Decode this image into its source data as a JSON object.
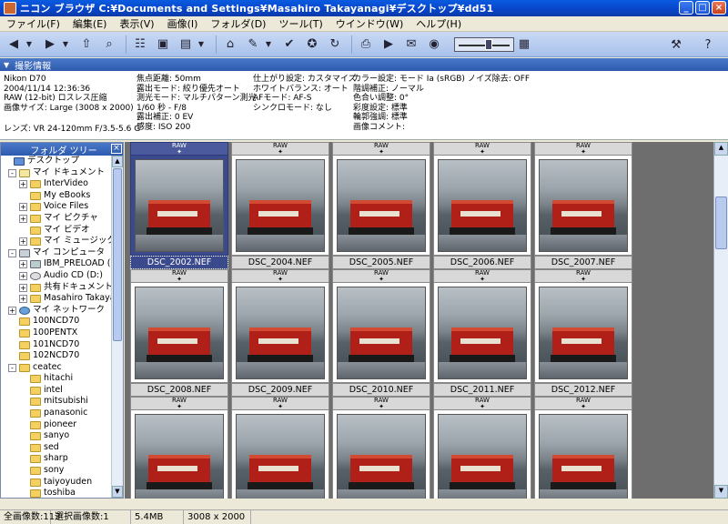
{
  "window": {
    "title": "ニコン ブラウザ C:¥Documents and Settings¥Masahiro Takayanagi¥デスクトップ¥dd51"
  },
  "menu": [
    "ファイル(F)",
    "編集(E)",
    "表示(V)",
    "画像(I)",
    "フォルダ(D)",
    "ツール(T)",
    "ウインドウ(W)",
    "ヘルプ(H)"
  ],
  "info_header": "撮影情報",
  "info_columns": [
    [
      "Nikon D70",
      "2004/11/14 12:36:36",
      "RAW (12-bit) ロスレス圧縮",
      "画像サイズ: Large (3008 x 2000)",
      "",
      "レンズ: VR 24-120mm F/3.5-5.6 G"
    ],
    [
      "焦点距離: 50mm",
      "露出モード: 絞り優先オート",
      "測光モード: マルチパターン測光",
      "1/60 秒 - F/8",
      "露出補正: 0 EV",
      "感度: ISO 200"
    ],
    [
      "仕上がり設定: カスタマイズ",
      "ホワイトバランス: オート",
      "AFモード: AF-S",
      "シンクロモード: なし"
    ],
    [
      "カラー設定: モード Ia (sRGB)",
      "階調補正: ノーマル",
      "色合い調整: 0°",
      "彩度設定: 標準",
      "輪郭強調: 標準",
      "画像コメント:"
    ],
    [
      "ノイズ除去: OFF"
    ]
  ],
  "folder_tree": {
    "title": "フォルダ ツリー",
    "items": [
      {
        "label": "デスクトップ",
        "level": 0,
        "icon": "desktop"
      },
      {
        "label": "マイ ドキュメント",
        "level": 1,
        "icon": "docs",
        "exp": "-"
      },
      {
        "label": "InterVideo",
        "level": 2,
        "icon": "folder",
        "exp": "+"
      },
      {
        "label": "My eBooks",
        "level": 2,
        "icon": "folder"
      },
      {
        "label": "Voice Files",
        "level": 2,
        "icon": "folder",
        "exp": "+"
      },
      {
        "label": "マイ ピクチャ",
        "level": 2,
        "icon": "folder",
        "exp": "+"
      },
      {
        "label": "マイ ビデオ",
        "level": 2,
        "icon": "folder"
      },
      {
        "label": "マイ ミュージック",
        "level": 2,
        "icon": "folder",
        "exp": "+"
      },
      {
        "label": "マイ コンピュータ",
        "level": 1,
        "icon": "pc",
        "exp": "-"
      },
      {
        "label": "IBM_PRELOAD (C",
        "level": 2,
        "icon": "drive",
        "exp": "+"
      },
      {
        "label": "Audio CD (D:)",
        "level": 2,
        "icon": "cd",
        "exp": "+"
      },
      {
        "label": "共有ドキュメント",
        "level": 2,
        "icon": "folder",
        "exp": "+"
      },
      {
        "label": "Masahiro Takayan",
        "level": 2,
        "icon": "folder",
        "exp": "+"
      },
      {
        "label": "マイ ネットワーク",
        "level": 1,
        "icon": "net",
        "exp": "+"
      },
      {
        "label": "100NCD70",
        "level": 1,
        "icon": "folder"
      },
      {
        "label": "100PENTX",
        "level": 1,
        "icon": "folder"
      },
      {
        "label": "101NCD70",
        "level": 1,
        "icon": "folder"
      },
      {
        "label": "102NCD70",
        "level": 1,
        "icon": "folder"
      },
      {
        "label": "ceatec",
        "level": 1,
        "icon": "folder",
        "exp": "-"
      },
      {
        "label": "hitachi",
        "level": 2,
        "icon": "folder"
      },
      {
        "label": "intel",
        "level": 2,
        "icon": "folder"
      },
      {
        "label": "mitsubishi",
        "level": 2,
        "icon": "folder"
      },
      {
        "label": "panasonic",
        "level": 2,
        "icon": "folder"
      },
      {
        "label": "pioneer",
        "level": 2,
        "icon": "folder"
      },
      {
        "label": "sanyo",
        "level": 2,
        "icon": "folder"
      },
      {
        "label": "sed",
        "level": 2,
        "icon": "folder"
      },
      {
        "label": "sharp",
        "level": 2,
        "icon": "folder"
      },
      {
        "label": "sony",
        "level": 2,
        "icon": "folder"
      },
      {
        "label": "taiyoyuden",
        "level": 2,
        "icon": "folder"
      },
      {
        "label": "toshiba",
        "level": 2,
        "icon": "folder"
      }
    ]
  },
  "thumbnails": {
    "badge": "RAW",
    "items": [
      {
        "name": "DSC_2002.NEF",
        "selected": true
      },
      {
        "name": "DSC_2004.NEF"
      },
      {
        "name": "DSC_2005.NEF"
      },
      {
        "name": "DSC_2006.NEF"
      },
      {
        "name": "DSC_2007.NEF"
      },
      {
        "name": "DSC_2008.NEF"
      },
      {
        "name": "DSC_2009.NEF"
      },
      {
        "name": "DSC_2010.NEF"
      },
      {
        "name": "DSC_2011.NEF"
      },
      {
        "name": "DSC_2012.NEF"
      },
      {
        "name": ""
      },
      {
        "name": ""
      },
      {
        "name": ""
      },
      {
        "name": ""
      },
      {
        "name": ""
      }
    ]
  },
  "status": [
    "全画像数:113",
    "選択画像数:1",
    "5.4MB",
    "3008 x 2000"
  ],
  "thumb_size_slider": 0.55
}
